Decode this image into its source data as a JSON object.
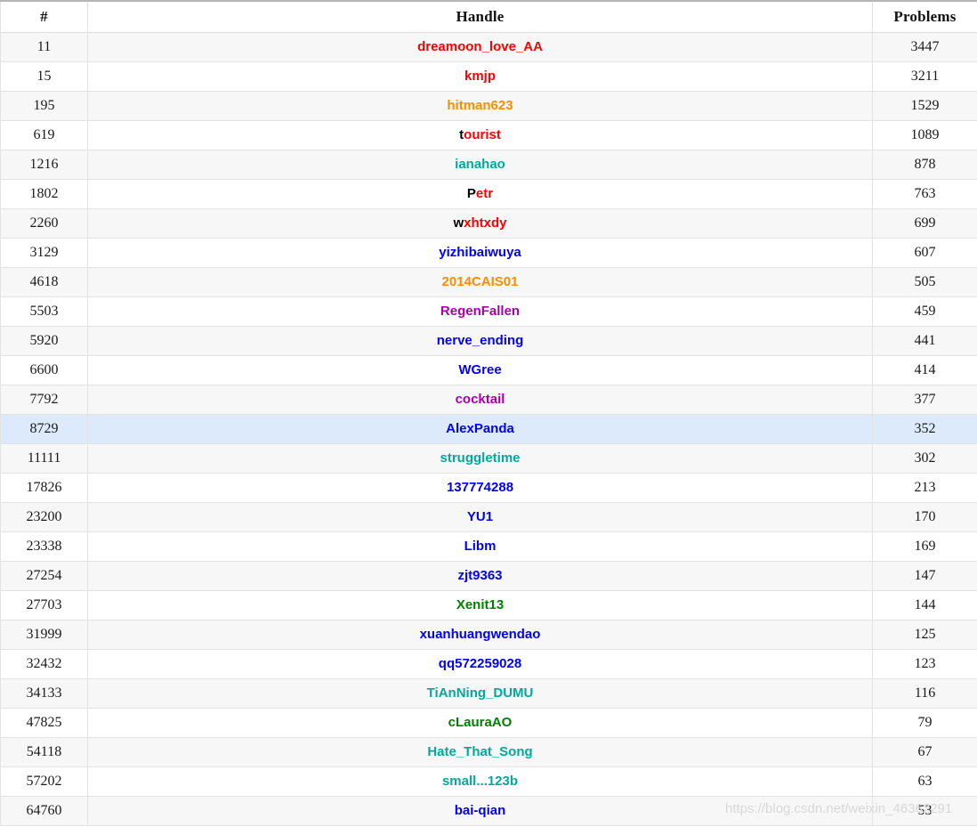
{
  "table": {
    "columns": [
      {
        "key": "rank",
        "label": "#"
      },
      {
        "key": "handle",
        "label": "Handle"
      },
      {
        "key": "problems",
        "label": "Problems"
      }
    ],
    "colors": {
      "legendary_grandmaster": "#ff0000",
      "international_grandmaster": "#ff0000",
      "grandmaster": "#ff0000",
      "master": "#ff8c00",
      "candidate_master": "#aa00aa",
      "expert": "#0000ff",
      "specialist": "#03a89e",
      "pupil": "#008000",
      "row_highlight": "#dceafb",
      "row_odd": "#f7f7f7",
      "row_even": "#ffffff",
      "border": "#e3e3e3",
      "header_text": "#111111",
      "watermark": "#d8d8d8"
    },
    "rows": [
      {
        "rank": "11",
        "handle": "dreamoon_love_AA",
        "lead": "",
        "rest": "dreamoon_love_AA",
        "color": "#ff0000",
        "problems": "3447",
        "highlight": false
      },
      {
        "rank": "15",
        "handle": "kmjp",
        "lead": "",
        "rest": "kmjp",
        "color": "#ff0000",
        "problems": "3211",
        "highlight": false
      },
      {
        "rank": "195",
        "handle": "hitman623",
        "lead": "",
        "rest": "hitman623",
        "color": "#ff8c00",
        "problems": "1529",
        "highlight": false
      },
      {
        "rank": "619",
        "handle": "tourist",
        "lead": "t",
        "rest": "ourist",
        "color": "#ff0000",
        "problems": "1089",
        "highlight": false
      },
      {
        "rank": "1216",
        "handle": "ianahao",
        "lead": "",
        "rest": "ianahao",
        "color": "#03a89e",
        "problems": "878",
        "highlight": false
      },
      {
        "rank": "1802",
        "handle": "Petr",
        "lead": "P",
        "rest": "etr",
        "color": "#ff0000",
        "problems": "763",
        "highlight": false
      },
      {
        "rank": "2260",
        "handle": "wxhtxdy",
        "lead": "w",
        "rest": "xhtxdy",
        "color": "#ff0000",
        "problems": "699",
        "highlight": false
      },
      {
        "rank": "3129",
        "handle": "yizhibaiwuya",
        "lead": "",
        "rest": "yizhibaiwuya",
        "color": "#0000ff",
        "problems": "607",
        "highlight": false
      },
      {
        "rank": "4618",
        "handle": "2014CAIS01",
        "lead": "",
        "rest": "2014CAIS01",
        "color": "#ff8c00",
        "problems": "505",
        "highlight": false
      },
      {
        "rank": "5503",
        "handle": "RegenFallen",
        "lead": "",
        "rest": "RegenFallen",
        "color": "#aa00aa",
        "problems": "459",
        "highlight": false
      },
      {
        "rank": "5920",
        "handle": "nerve_ending",
        "lead": "",
        "rest": "nerve_ending",
        "color": "#0000ff",
        "problems": "441",
        "highlight": false
      },
      {
        "rank": "6600",
        "handle": "WGree",
        "lead": "",
        "rest": "WGree",
        "color": "#0000ff",
        "problems": "414",
        "highlight": false
      },
      {
        "rank": "7792",
        "handle": "cocktail",
        "lead": "",
        "rest": "cocktail",
        "color": "#aa00aa",
        "problems": "377",
        "highlight": false
      },
      {
        "rank": "8729",
        "handle": "AlexPanda",
        "lead": "",
        "rest": "AlexPanda",
        "color": "#0000ff",
        "problems": "352",
        "highlight": true
      },
      {
        "rank": "11111",
        "handle": "struggletime",
        "lead": "",
        "rest": "struggletime",
        "color": "#03a89e",
        "problems": "302",
        "highlight": false
      },
      {
        "rank": "17826",
        "handle": "137774288",
        "lead": "",
        "rest": "137774288",
        "color": "#0000ff",
        "problems": "213",
        "highlight": false
      },
      {
        "rank": "23200",
        "handle": "YU1",
        "lead": "",
        "rest": "YU1",
        "color": "#0000ff",
        "problems": "170",
        "highlight": false
      },
      {
        "rank": "23338",
        "handle": "Libm",
        "lead": "",
        "rest": "Libm",
        "color": "#0000ff",
        "problems": "169",
        "highlight": false
      },
      {
        "rank": "27254",
        "handle": "zjt9363",
        "lead": "",
        "rest": "zjt9363",
        "color": "#0000ff",
        "problems": "147",
        "highlight": false
      },
      {
        "rank": "27703",
        "handle": "Xenit13",
        "lead": "",
        "rest": "Xenit13",
        "color": "#008000",
        "problems": "144",
        "highlight": false
      },
      {
        "rank": "31999",
        "handle": "xuanhuangwendao",
        "lead": "",
        "rest": "xuanhuangwendao",
        "color": "#0000ff",
        "problems": "125",
        "highlight": false
      },
      {
        "rank": "32432",
        "handle": "qq572259028",
        "lead": "",
        "rest": "qq572259028",
        "color": "#0000ff",
        "problems": "123",
        "highlight": false
      },
      {
        "rank": "34133",
        "handle": "TiAnNing_DUMU",
        "lead": "",
        "rest": "TiAnNing_DUMU",
        "color": "#03a89e",
        "problems": "116",
        "highlight": false
      },
      {
        "rank": "47825",
        "handle": "cLauraAO",
        "lead": "",
        "rest": "cLauraAO",
        "color": "#008000",
        "problems": "79",
        "highlight": false
      },
      {
        "rank": "54118",
        "handle": "Hate_That_Song",
        "lead": "",
        "rest": "Hate_That_Song",
        "color": "#03a89e",
        "problems": "67",
        "highlight": false
      },
      {
        "rank": "57202",
        "handle": "small...123b",
        "lead": "",
        "rest": "small...123b",
        "color": "#03a89e",
        "problems": "63",
        "highlight": false
      },
      {
        "rank": "64760",
        "handle": "bai-qian",
        "lead": "",
        "rest": "bai-qian",
        "color": "#0000ff",
        "problems": "53",
        "highlight": false
      }
    ]
  },
  "watermark": {
    "text": "https://blog.csdn.net/weixin_46362291"
  }
}
